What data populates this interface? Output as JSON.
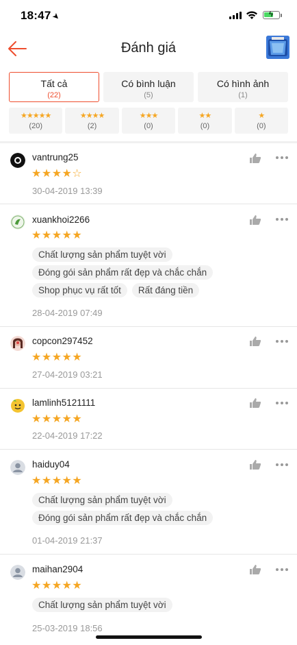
{
  "status_bar": {
    "time": "18:47"
  },
  "header": {
    "title": "Đánh giá"
  },
  "tabs": [
    {
      "label": "Tất cả",
      "count": "(22)"
    },
    {
      "label": "Có bình luận",
      "count": "(5)"
    },
    {
      "label": "Có hình ảnh",
      "count": "(1)"
    }
  ],
  "star_filters": [
    {
      "stars": "★★★★★",
      "count": "(20)"
    },
    {
      "stars": "★★★★",
      "count": "(2)"
    },
    {
      "stars": "★★★",
      "count": "(0)"
    },
    {
      "stars": "★★",
      "count": "(0)"
    },
    {
      "stars": "★",
      "count": "(0)"
    }
  ],
  "reviews": [
    {
      "username": "vantrung25",
      "stars": "★★★★",
      "empty_stars": "☆",
      "rating": 4,
      "tags": [],
      "date": "30-04-2019 13:39"
    },
    {
      "username": "xuankhoi2266",
      "stars": "★★★★★",
      "empty_stars": "",
      "rating": 5,
      "tags": [
        "Chất lượng sản phẩm tuyệt vời",
        "Đóng gói sản phẩm rất đẹp và chắc chắn",
        "Shop phục vụ rất tốt",
        "Rất đáng tiền"
      ],
      "date": "28-04-2019 07:49"
    },
    {
      "username": "copcon297452",
      "stars": "★★★★★",
      "empty_stars": "",
      "rating": 5,
      "tags": [],
      "date": "27-04-2019 03:21"
    },
    {
      "username": "lamlinh5121111",
      "stars": "★★★★★",
      "empty_stars": "",
      "rating": 5,
      "tags": [],
      "date": "22-04-2019 17:22"
    },
    {
      "username": "haiduy04",
      "stars": "★★★★★",
      "empty_stars": "",
      "rating": 5,
      "tags": [
        "Chất lượng sản phẩm tuyệt vời",
        "Đóng gói sản phẩm rất đẹp và chắc chắn"
      ],
      "date": "01-04-2019 21:37"
    },
    {
      "username": "maihan2904",
      "stars": "★★★★★",
      "empty_stars": "",
      "rating": 5,
      "tags": [
        "Chất lượng sản phẩm tuyệt vời"
      ],
      "date": "25-03-2019 18:56"
    }
  ],
  "colors": {
    "accent": "#ee4d2d",
    "star": "#f5a623"
  },
  "icons": [
    "back-arrow-icon",
    "thumbs-up-icon",
    "more-dots-icon",
    "location-arrow-icon",
    "wifi-icon",
    "battery-icon"
  ]
}
